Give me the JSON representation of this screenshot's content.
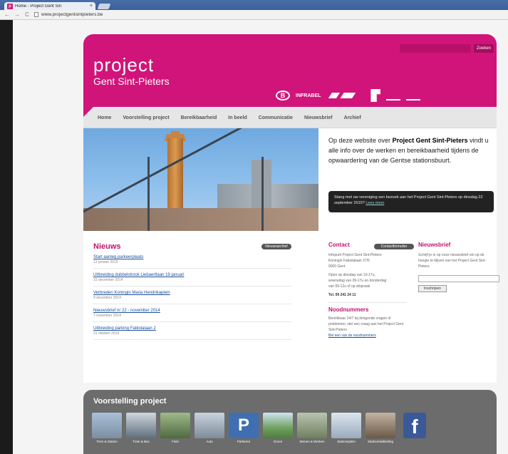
{
  "browser": {
    "tab_title": "Home - Project Gent Sin",
    "tab_close": "×",
    "favicon": "p",
    "url": "www.projectgentsintpieters.be"
  },
  "header": {
    "logo_line1": "project",
    "logo_line2": "Gent Sint-Pieters",
    "search_button": "Zoeken",
    "partners": [
      "B",
      "INFRABEL"
    ]
  },
  "nav": {
    "items": [
      "Home",
      "Voorstelling project",
      "Bereikbaarheid",
      "In beeld",
      "Communicatie",
      "Nieuwsbrief",
      "Archief"
    ]
  },
  "intro": {
    "prefix": "Op deze website over ",
    "bold": "Project Gent Sint-Pieters",
    "suffix": " vindt u alle info over de werken en bereikbaarheid tijdens de opwaardering van de Gentse stationsbuurt."
  },
  "notice": {
    "text": "Stang met uw vereniging een bezoek aan het Project Gent Sint-Pieters op dinsdag 22 september 2015?",
    "link": "Lees meer"
  },
  "news": {
    "title": "Nieuws",
    "archive_button": "Nieuwsarchief",
    "items": [
      {
        "title": "Start aanleg parkeerplaats",
        "date": "13 januari 2015"
      },
      {
        "title": "Uitbreiding dubbelstrook Liebaertlaan 19 januari",
        "date": "15 december 2014"
      },
      {
        "title": "Verbreden Koningin Maria Hendrikaplein",
        "date": "9 december 2014"
      },
      {
        "title": "Nieuwsbrief nr 22 - november 2014",
        "date": "7 november 2014"
      },
      {
        "title": "Uitbreiding parking Fabiolalaan 2",
        "date": "31 oktober 2014"
      }
    ]
  },
  "contact": {
    "title": "Contact",
    "form_button": "Contactformulier",
    "lines": [
      "Infopunt Project Gent Sint-Pieters",
      "Koningin Fabiolalaan 27/5",
      "9000 Gent",
      "",
      "Open op dinsdag van 10-17u,",
      "woensdag van 09-17u en donderdag",
      "van 09-12u of op afspraak"
    ],
    "tel": "Tel. 09 241 24 11",
    "noodnummers_title": "Noodnummers",
    "noodnummers_text": "Bereikbaar 24/7 bij dringende vragen of problemen, stel een vraag aan het Project Gent Sint-Pieters",
    "noodnummers_link": "Bel een van de noodnummers"
  },
  "newsletter": {
    "title": "Nieuwsbrief",
    "text": "Schrijf je in op onze nieuwsbrief om op de hoogte te blijven van het Project Gent Sint-Pieters.",
    "button": "Inschrijven",
    "input_value": ""
  },
  "voorstelling": {
    "title": "Voorstelling project",
    "thumbs": [
      {
        "label": "Trein & Station",
        "color": "#8aa4c0"
      },
      {
        "label": "Tram & Bus",
        "color": "#6e7f8f"
      },
      {
        "label": "Fiets",
        "color": "#6f8b5a"
      },
      {
        "label": "Auto",
        "color": "#9aa9b9"
      },
      {
        "label": "Parkeren",
        "color": "#4a78b6"
      },
      {
        "label": "Groen",
        "color": "#6fa05e"
      },
      {
        "label": "Wonen & Werken",
        "color": "#7f8f6f"
      },
      {
        "label": "Stationsplein",
        "color": "#a7b7c7"
      },
      {
        "label": "Stadsontwikkeling",
        "color": "#7d6a58"
      }
    ]
  }
}
